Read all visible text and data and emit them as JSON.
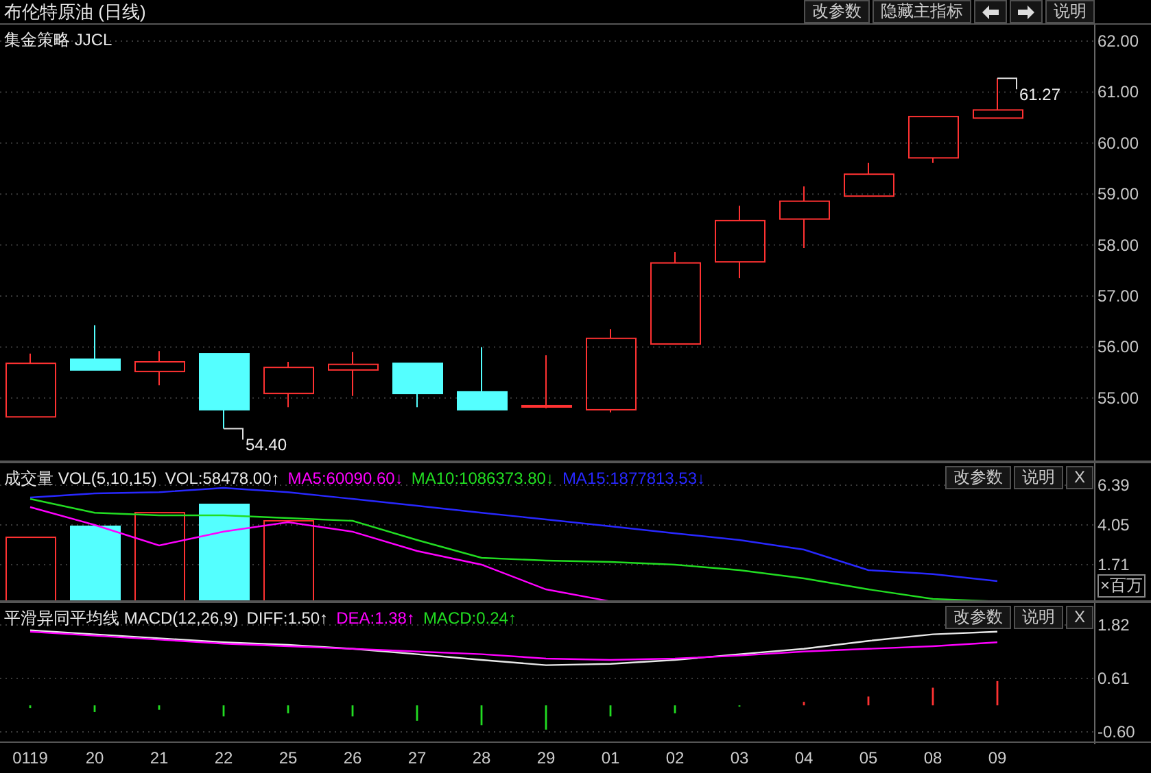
{
  "title_bar": {
    "title": "布伦特原油 (日线)",
    "buttons": [
      {
        "kind": "text",
        "label": "改参数"
      },
      {
        "kind": "text",
        "label": "隐藏主指标"
      },
      {
        "kind": "arrow-left"
      },
      {
        "kind": "arrow-right"
      },
      {
        "kind": "text",
        "label": "说明"
      }
    ]
  },
  "price_panel": {
    "label": "集金策略 JJCL",
    "price_labels": [
      "54.40",
      "61.27"
    ],
    "y_axis_labels": [
      "62.00",
      "61.00",
      "60.00",
      "59.00",
      "58.00",
      "57.00",
      "56.00",
      "55.00"
    ]
  },
  "volume_panel": {
    "legend": [
      {
        "text": "成交量 VOL(5,10,15)",
        "color": "#e8e8e8"
      },
      {
        "text": "VOL:58478.00↑",
        "color": "#e8e8e8"
      },
      {
        "text": "MA5:60090.60↓",
        "color": "#ff00ff"
      },
      {
        "text": "MA10:1086373.80↓",
        "color": "#22dd22"
      },
      {
        "text": "MA15:1877813.53↓",
        "color": "#2828ff"
      }
    ],
    "buttons": [
      "改参数",
      "说明",
      "X"
    ],
    "unit": "×百万",
    "y_axis_labels": [
      "6.39",
      "4.05",
      "1.71"
    ]
  },
  "macd_panel": {
    "legend": [
      {
        "text": "平滑异同平均线 MACD(12,26,9)",
        "color": "#e8e8e8"
      },
      {
        "text": "DIFF:1.50↑",
        "color": "#e8e8e8"
      },
      {
        "text": "DEA:1.38↑",
        "color": "#ff00ff"
      },
      {
        "text": "MACD:0.24↑",
        "color": "#22dd22"
      }
    ],
    "buttons": [
      "改参数",
      "说明",
      "X"
    ],
    "y_axis_labels": [
      "1.82",
      "0.61",
      "-0.60"
    ]
  },
  "x_axis_labels": [
    "0119",
    "20",
    "21",
    "22",
    "25",
    "26",
    "27",
    "28",
    "29",
    "01",
    "02",
    "03",
    "04",
    "05",
    "08",
    "09"
  ]
}
